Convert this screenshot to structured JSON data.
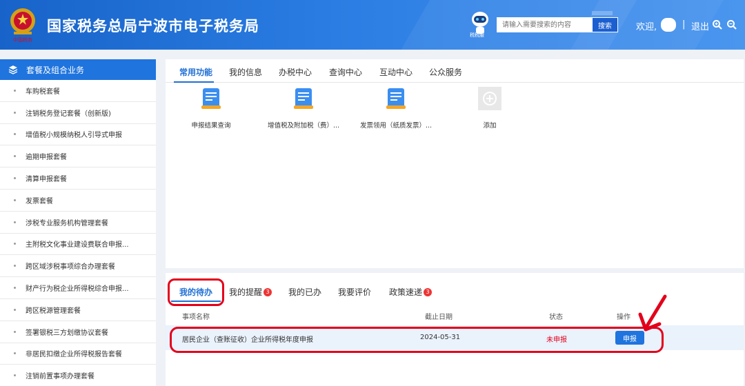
{
  "header": {
    "title": "国家税务总局宁波市电子税务局",
    "robot_label": "税税服",
    "search_placeholder": "请输入需要搜索的内容",
    "search_button": "搜索",
    "welcome": "欢迎,",
    "separator": "|",
    "logout": "退出",
    "colors": {
      "primary": "#1f74de",
      "accent_red": "#e3001b"
    }
  },
  "sidebar": {
    "title": "套餐及组合业务",
    "items": [
      "车购税套餐",
      "注销税务登记套餐（创新版)",
      "增值税小规模纳税人引导式申报",
      "逾期申报套餐",
      "清算申报套餐",
      "发票套餐",
      "涉税专业服务机构管理套餐",
      "主附税文化事业建设费联合申报...",
      "跨区域涉税事项综合办理套餐",
      "财产行为税企业所得税综合申报...",
      "跨区税源管理套餐",
      "签署银税三方划缴协议套餐",
      "非居民扣缴企业所得税报告套餐",
      "注销前置事项办理套餐"
    ]
  },
  "top_tabs": [
    "常用功能",
    "我的信息",
    "办税中心",
    "查询中心",
    "互动中心",
    "公众服务"
  ],
  "functions": [
    "申报结果查询",
    "增值税及附加税（费）...",
    "发票领用（纸质发票）...",
    "添加"
  ],
  "bottom_tabs": [
    {
      "label": "我的待办",
      "badge": ""
    },
    {
      "label": "我的提醒",
      "badge": "3"
    },
    {
      "label": "我的已办",
      "badge": ""
    },
    {
      "label": "我要评价",
      "badge": ""
    },
    {
      "label": "政策速递",
      "badge": "3"
    }
  ],
  "todo_table": {
    "headers": [
      "事项名称",
      "截止日期",
      "状态",
      "操作"
    ],
    "rows": [
      {
        "name": "居民企业（查账征收）企业所得税年度申报",
        "deadline": "2024-05-31",
        "status": "未申报",
        "action": "申报"
      }
    ]
  }
}
